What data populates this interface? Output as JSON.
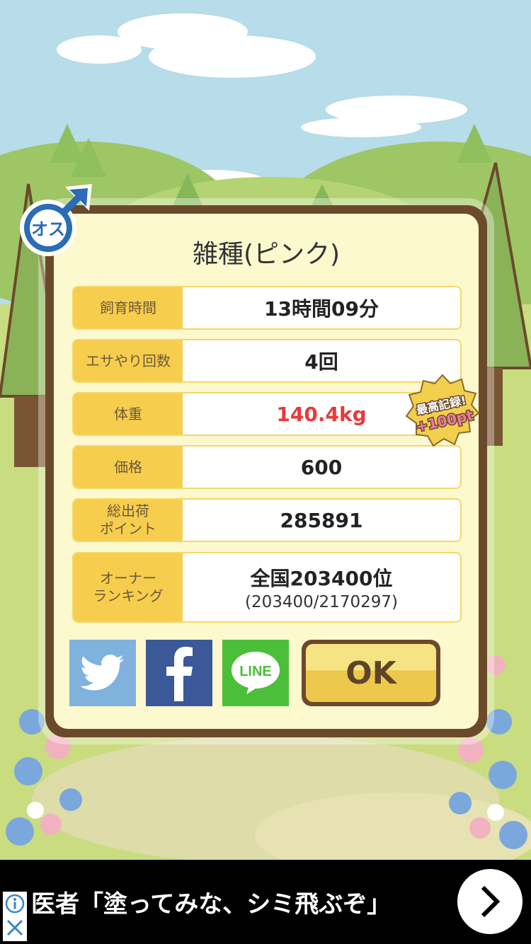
{
  "colors": {
    "sky": "#b7dcea",
    "card_bg": "#fdf9cf",
    "label_bg": "#f7cd4d",
    "frame": "#6b4a2b",
    "weight_red": "#e53a3a"
  },
  "gender_badge": {
    "text": "オス",
    "icon": "male-symbol-icon"
  },
  "title": "雑種(ピンク)",
  "rows": [
    {
      "label": "飼育時間",
      "value": "13時間09分"
    },
    {
      "label": "エサやり回数",
      "value": "4回"
    },
    {
      "label": "体重",
      "value": "140.4kg"
    },
    {
      "label": "価格",
      "value": "600"
    },
    {
      "label": "総出荷\nポイント",
      "value": "285891"
    },
    {
      "label": "オーナー\nランキング",
      "value": "全国203400位",
      "sub": "(203400/2170297)"
    }
  ],
  "record_badge": {
    "line1": "最高記録!",
    "line2": "+100pt"
  },
  "share": {
    "twitter": "twitter-icon",
    "facebook": "facebook-icon",
    "line": "LINE"
  },
  "ok_label": "OK",
  "ad": {
    "text": "医者「塗ってみな、シミ飛ぶぞ」",
    "info_icon": "info-icon",
    "close_icon": "close-icon",
    "next_icon": "chevron-right-icon"
  }
}
